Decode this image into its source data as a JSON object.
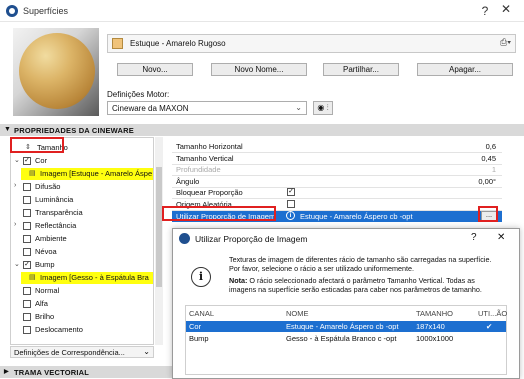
{
  "window": {
    "title": "Superfícies"
  },
  "material": {
    "name": "Estuque - Amarelo Rugoso",
    "swatch_color": "#f0c37a"
  },
  "buttons": {
    "new": "Novo...",
    "new_name": "Novo Nome...",
    "share": "Partilhar...",
    "delete": "Apagar..."
  },
  "engine": {
    "label": "Definições Motor:",
    "value": "Cineware da MAXON"
  },
  "sections": {
    "cineware": "PROPRIEDADES DA CINEWARE",
    "vector": "TRAMA VECTORIAL"
  },
  "tree": {
    "items": [
      {
        "label": "Tamanho",
        "checked": null,
        "expand": "",
        "indent": 0
      },
      {
        "label": "Cor",
        "checked": true,
        "expand": "v",
        "indent": 0
      },
      {
        "label": "Imagem [Estuque - Amarelo Áspe",
        "checked": null,
        "expand": "",
        "indent": 1
      },
      {
        "label": "Difusão",
        "checked": false,
        "expand": ">",
        "indent": 0
      },
      {
        "label": "Luminância",
        "checked": false,
        "expand": "",
        "indent": 0
      },
      {
        "label": "Transparência",
        "checked": false,
        "expand": "",
        "indent": 0
      },
      {
        "label": "Reflectância",
        "checked": false,
        "expand": ">",
        "indent": 0
      },
      {
        "label": "Ambiente",
        "checked": false,
        "expand": "",
        "indent": 0
      },
      {
        "label": "Névoa",
        "checked": false,
        "expand": "",
        "indent": 0
      },
      {
        "label": "Bump",
        "checked": true,
        "expand": "v",
        "indent": 0
      },
      {
        "label": "Imagem [Gesso - à Espátula Bra",
        "checked": null,
        "expand": "",
        "indent": 1
      },
      {
        "label": "Normal",
        "checked": false,
        "expand": "",
        "indent": 0
      },
      {
        "label": "Alfa",
        "checked": false,
        "expand": "",
        "indent": 0
      },
      {
        "label": "Brilho",
        "checked": false,
        "expand": "",
        "indent": 0
      },
      {
        "label": "Deslocamento",
        "checked": false,
        "expand": "",
        "indent": 0
      }
    ],
    "footer": "Definições de Correspondência..."
  },
  "props": {
    "rows": [
      {
        "label": "Tamanho Horizontal",
        "value": "0,6"
      },
      {
        "label": "Tamanho Vertical",
        "value": "0,45"
      },
      {
        "label": "Profundidade",
        "value": "1"
      },
      {
        "label": "Ângulo",
        "value": "0,00°"
      },
      {
        "label": "Bloquear Proporção",
        "value": ""
      },
      {
        "label": "Origem Aleatória",
        "value": ""
      }
    ],
    "selected_label": "Utilizar Proporção de Imagem",
    "selected_value": "Estuque - Amarelo Áspero cb -opt",
    "more_button": "..."
  },
  "dialog": {
    "title": "Utilizar Proporção de Imagem",
    "message": "Texturas de imagem de diferentes rácio de tamanho são carregadas na superfície. Por favor, selecione o rácio a ser utilizado uniformemente.",
    "note_bold": "Nota:",
    "note": " O rácio seleccionado afectará o parâmetro Tamanho Vertical. Todas as imagens na superfície serão esticadas para caber nos parâmetros de tamanho.",
    "columns": [
      "CANAL",
      "NOME",
      "TAMANHO",
      "UTI...ÃO"
    ],
    "rows": [
      {
        "channel": "Cor",
        "name": "Estuque - Amarelo Áspero cb -opt",
        "size": "187x140",
        "use": "✔"
      },
      {
        "channel": "Bump",
        "name": "Gesso - à Espátula Branco c -opt",
        "size": "1000x1000",
        "use": ""
      }
    ]
  },
  "colors": {
    "selection": "#1d6fd0",
    "highlight": "#ffff10",
    "annotation": "#e02020"
  }
}
